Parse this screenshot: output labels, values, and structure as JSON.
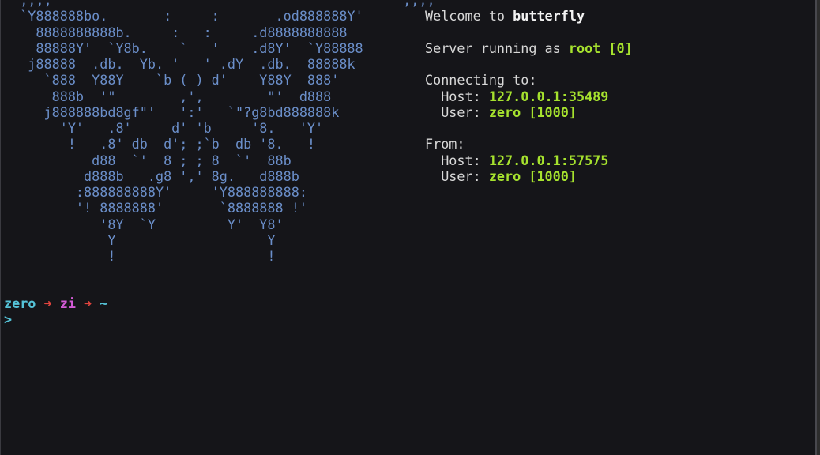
{
  "art": {
    "lines": [
      "  ;,,,                                            ,,,;",
      "  `Y888888bo.       :     :       .od888888Y'",
      "    8888888888b.     :   :     .d8888888888",
      "    88888Y'  `Y8b.    `   '    .d8Y'  `Y88888",
      "   j88888  .db.  Yb. '   ' .dY  .db.  88888k",
      "     `888  Y88Y    `b ( ) d'    Y88Y  888'",
      "      888b  '\"        ,',        \"'  d888",
      "     j888888bd8gf\"'   ':'   `\"?g8bd888888k",
      "       'Y'   .8'     d' 'b     '8.   'Y'",
      "        !   .8' db  d'; ;`b  db '8.   !",
      "           d88  `'  8 ; ; 8  `'  88b",
      "          d888b   .g8 ',' 8g.   d888b",
      "         :888888888Y'     'Y888888888:",
      "         '! 8888888'       `8888888 !'",
      "            '8Y  `Y         Y'  Y8'",
      "             Y                   Y",
      "             !                   !"
    ]
  },
  "info": {
    "welcome_prefix": "Welcome to ",
    "welcome_name": "butterfly",
    "server_prefix": "Server running as ",
    "server_user": "root [0]",
    "connecting_label": "Connecting to:",
    "connecting_host_label": "  Host: ",
    "connecting_host_value": "127.0.0.1:35489",
    "connecting_user_label": "  User: ",
    "connecting_user_value": "zero [1000]",
    "from_label": "From:",
    "from_host_label": "  Host: ",
    "from_host_value": "127.0.0.1:57575",
    "from_user_label": "  User: ",
    "from_user_value": "zero [1000]"
  },
  "prompt": {
    "user": "zero",
    "sep1": " ➜ ",
    "host": "zi",
    "sep2": " ➜ ",
    "path": "~",
    "caret": ">"
  },
  "colors": {
    "background": "#151519",
    "art": "#6b8fca",
    "highlight_green": "#a6e22e",
    "prompt_cyan": "#55c3d8",
    "prompt_red": "#e0443e",
    "prompt_magenta": "#d35bd6"
  }
}
